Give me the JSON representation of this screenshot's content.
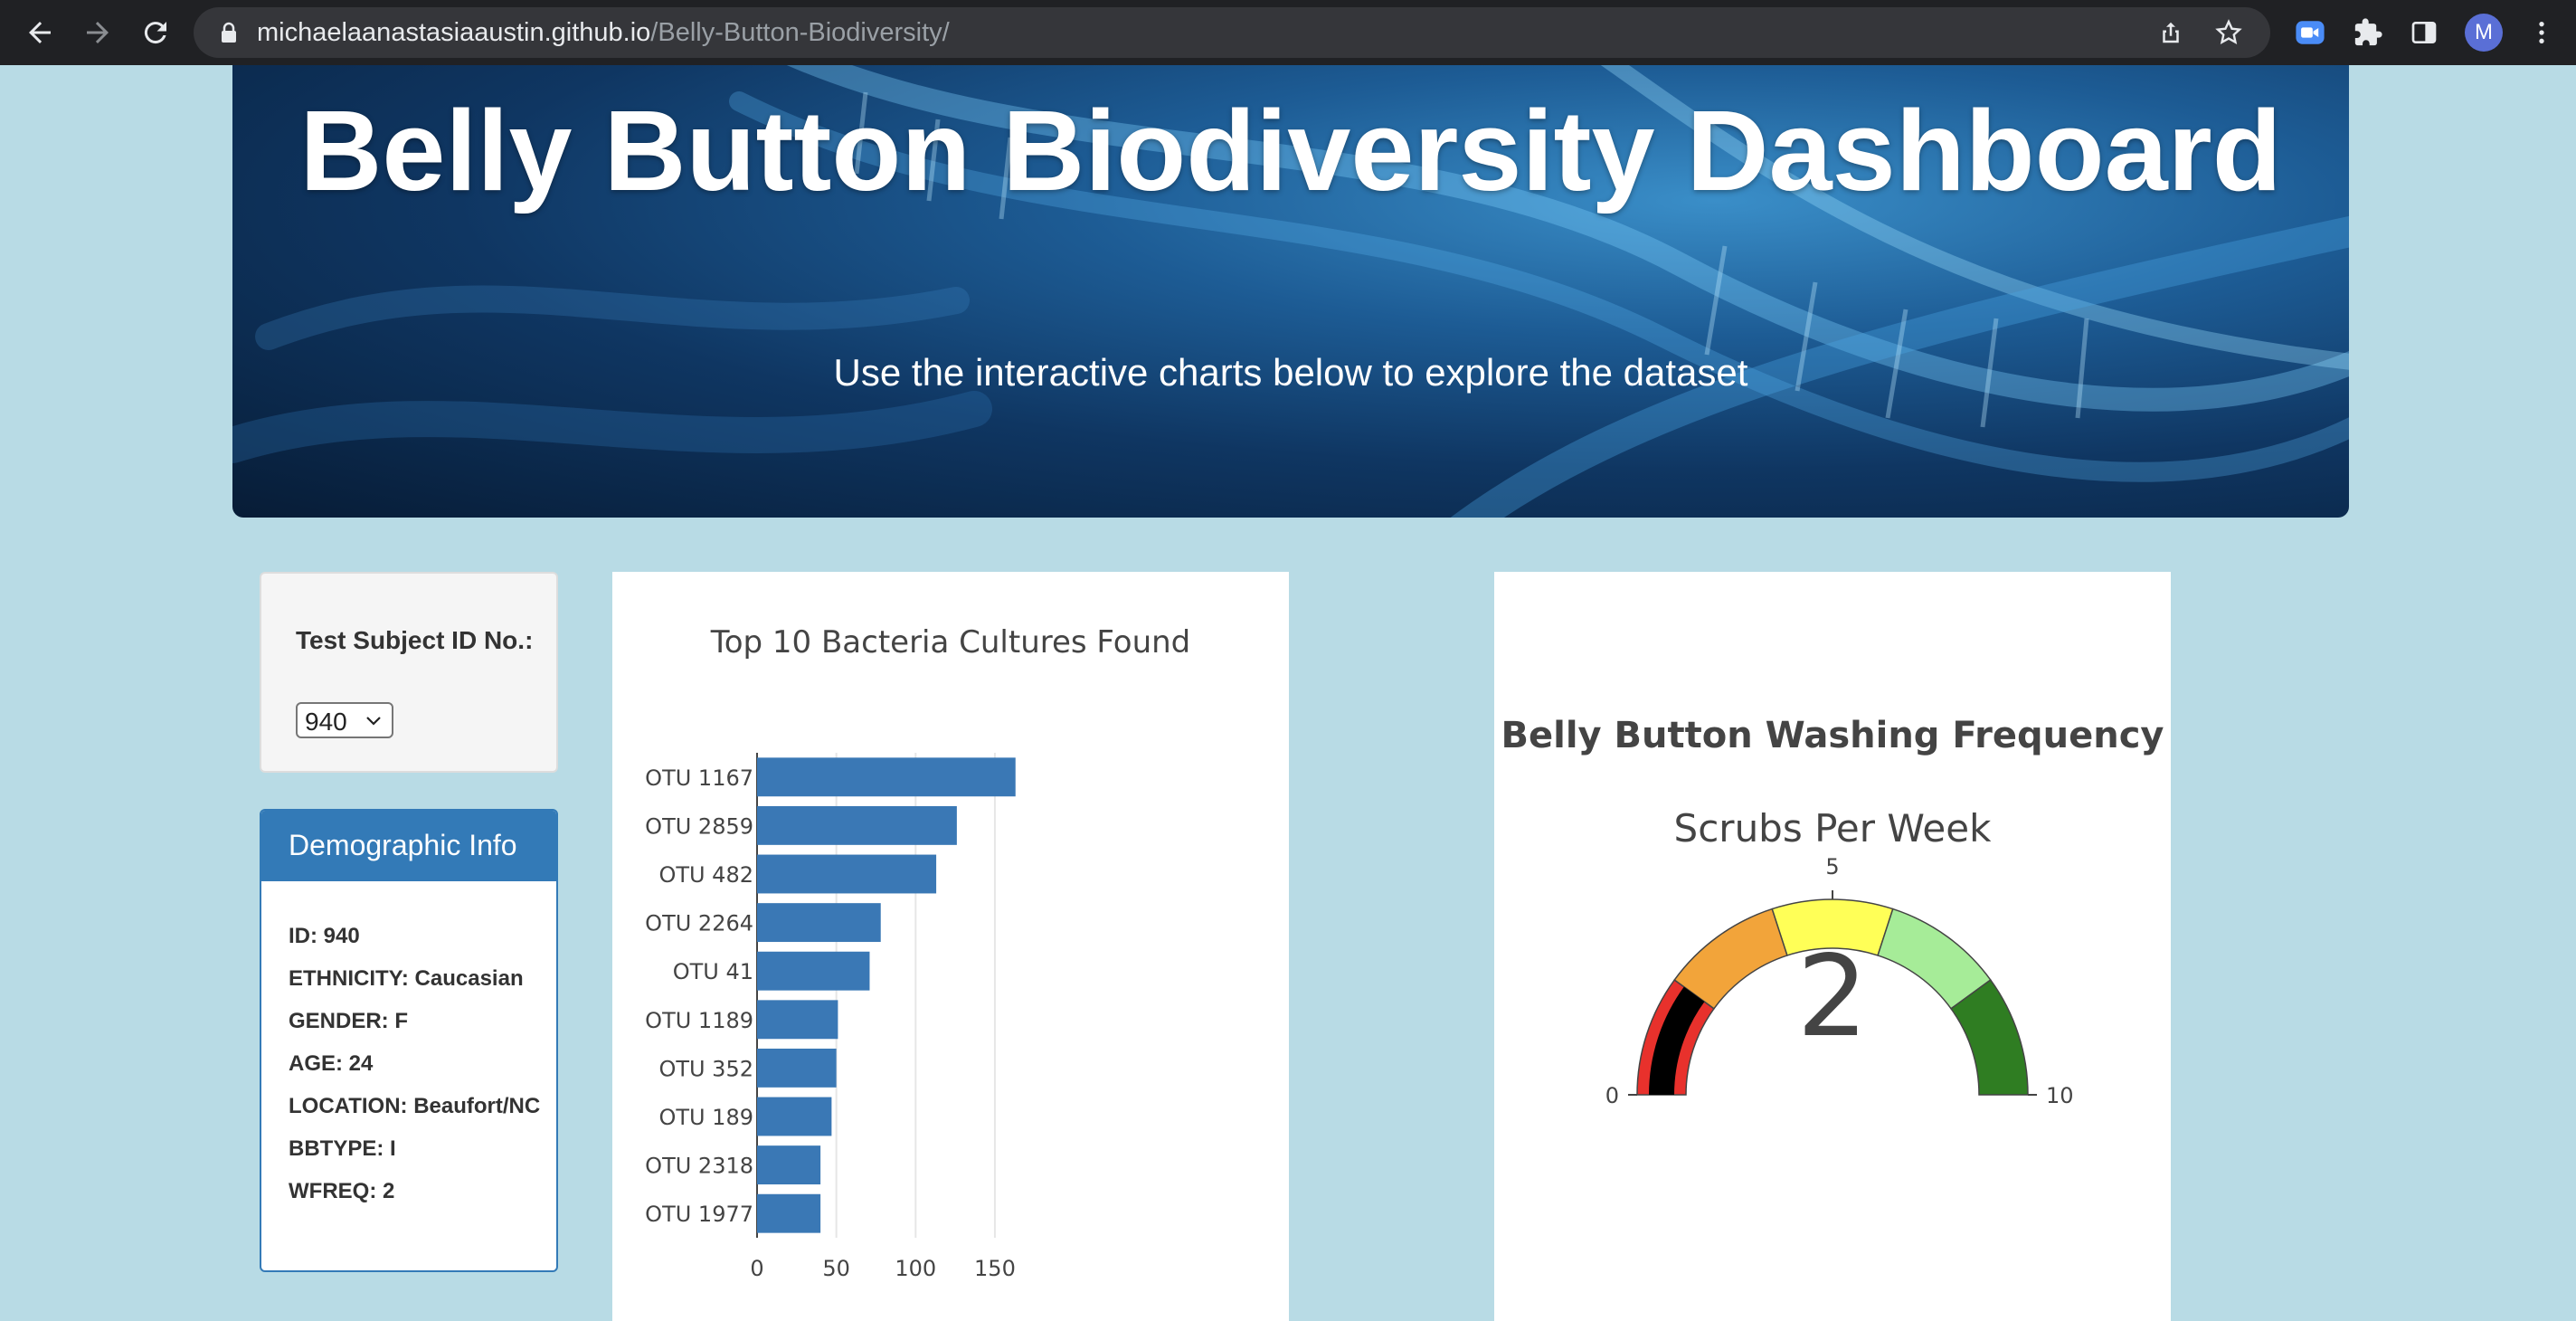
{
  "browser": {
    "url_host": "michaelaanastasiaaustin.github.io",
    "url_path": "/Belly-Button-Biodiversity/",
    "profile_initial": "M"
  },
  "hero": {
    "title": "Belly Button Biodiversity Dashboard",
    "subtitle": "Use the interactive charts below to explore the dataset"
  },
  "selector": {
    "label": "Test Subject ID No.:",
    "value": "940"
  },
  "demographics": {
    "title": "Demographic Info",
    "rows": [
      "ID: 940",
      "ETHNICITY: Caucasian",
      "GENDER: F",
      "AGE: 24",
      "LOCATION: Beaufort/NC",
      "BBTYPE: I",
      "WFREQ: 2"
    ]
  },
  "gauge": {
    "title": "Belly Button Washing Frequency",
    "subtitle": "Scrubs Per Week",
    "value": 2,
    "min": 0,
    "max": 10,
    "ticks": [
      "0",
      "5",
      "10"
    ],
    "bands": [
      {
        "from": 0,
        "to": 2,
        "color": "#e8312c"
      },
      {
        "from": 2,
        "to": 4,
        "color": "#f2a43a"
      },
      {
        "from": 4,
        "to": 6,
        "color": "#ffff57"
      },
      {
        "from": 6,
        "to": 8,
        "color": "#a6ec98"
      },
      {
        "from": 8,
        "to": 10,
        "color": "#2f7d22"
      }
    ],
    "bar_color": "#000000"
  },
  "chart_data": {
    "type": "bar",
    "orientation": "horizontal",
    "title": "Top 10 Bacteria Cultures Found",
    "categories": [
      "OTU 1167",
      "OTU 2859",
      "OTU 482",
      "OTU 2264",
      "OTU 41",
      "OTU 1189",
      "OTU 352",
      "OTU 189",
      "OTU 2318",
      "OTU 1977"
    ],
    "values": [
      163,
      126,
      113,
      78,
      71,
      51,
      50,
      47,
      40,
      40
    ],
    "xlim": [
      0,
      170
    ],
    "xticks": [
      0,
      50,
      100,
      150
    ],
    "grid": true,
    "color": "#3a78b5"
  }
}
